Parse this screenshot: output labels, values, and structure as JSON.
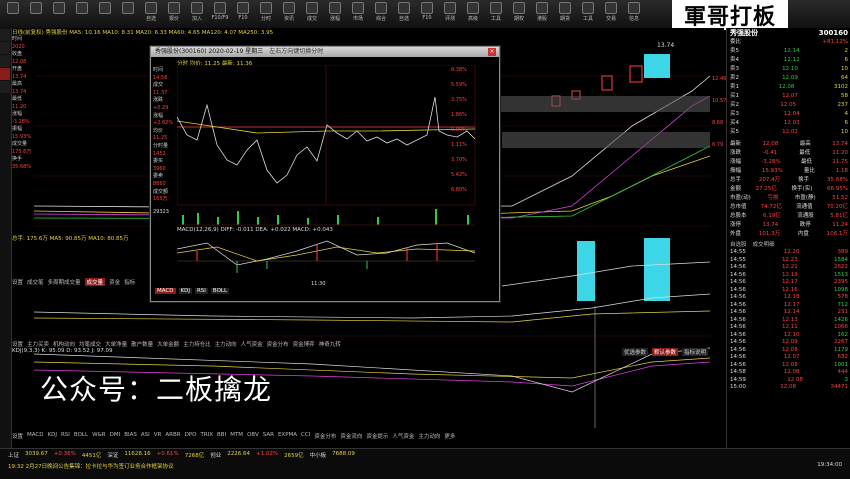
{
  "toolbar": {
    "buttons": [
      "",
      "",
      "",
      "",
      "",
      "",
      "自选",
      "报价",
      "加入",
      "F10/F9",
      "F10",
      "分时",
      "资讯",
      "成交",
      "涨幅",
      "市场",
      "综合",
      "自选",
      "F10",
      "评测",
      "高级",
      "工具",
      "期权",
      "港股",
      "期货",
      "工具",
      "交易",
      "信息"
    ]
  },
  "brand": {
    "text": "軍哥打板"
  },
  "watermark": {
    "text": "公众号：二板擒龙"
  },
  "stock": {
    "name": "秀强股份",
    "code": "300160"
  },
  "main": {
    "header": "日线(前复权)  秀强股份  MA5: 10.16  MA10: 8.31  MA20: 6.33  MA60: 4.65  MA120: 4.07  MA250: 3.95",
    "high_label": "13.74",
    "vol_header": "总手: 175.6万  MA5: 90.85万  MA10: 80.85万",
    "indicator_header": "MACD(12,26,9)",
    "tabs1": [
      "设置",
      "成交笔",
      "多周期成交量",
      "成交量",
      "资金",
      "指标"
    ],
    "tabs1_active": "成交量",
    "tabs2": [
      "设置",
      "主力买卖",
      "机构动向",
      "均笔成交",
      "大单净量",
      "散户数量",
      "大单金额",
      "主力持仓比",
      "主力动向",
      "人气资金",
      "资金分布",
      "资金博弈",
      "神奇九转"
    ],
    "tabs2_active": "资金博弈",
    "indicator2_header": "KDJ(9,3,3)  K: 95.09  D: 93.52  J: 97.09",
    "btns": [
      "优选参数",
      "默认参数",
      "指标说明"
    ],
    "bottom_tabs": [
      "设置",
      "MACD",
      "KDJ",
      "RSI",
      "BOLL",
      "W&R",
      "DMI",
      "BIAS",
      "ASI",
      "VR",
      "ARBR",
      "DPO",
      "TRIX",
      "BBI",
      "MTM",
      "OBV",
      "SAR",
      "EXPMA",
      "CCI",
      "资金分布",
      "资金流向",
      "资金提示",
      "人气资金",
      "主力动向",
      "更多"
    ],
    "bottom_active": "KDJ",
    "price_ticks": [
      "12.46",
      "10.57",
      "8.68",
      "6.79"
    ],
    "vol_ticks": [
      "3.40",
      "2.10",
      "1.50"
    ]
  },
  "popup": {
    "title": "秀强股份(300160)  2020-02-19  星期三",
    "subtitle": "左右方向键切换分时",
    "header_line": "分时  均价: 11.25  最新: 11.36",
    "fields": [
      "时间",
      "14:56",
      "成交",
      "11.37",
      "涨跌",
      "+0.29",
      "涨幅",
      "+2.62%",
      "均价",
      "11.25",
      "分时量",
      "1452",
      "委买",
      "3960",
      "委卖",
      "8860",
      "成交额",
      "165万"
    ],
    "pct_ticks": [
      "8.38%",
      "5.59%",
      "3.75%",
      "1.86%",
      "0.00%",
      "1.11%",
      "3.70%",
      "5.42%",
      "6.80%"
    ],
    "vol_label": "29323",
    "macd_header": "MACD(12,26,9)  DIFF: -0.011  DEA: +0.022  MACD: +0.043",
    "macd_ticks": [
      "+0.092",
      "+0.050",
      "0.000",
      "-0.010",
      "-0.079"
    ],
    "tabs": [
      "MACD",
      "KDJ",
      "RSI",
      "BOLL"
    ],
    "time_label": "11:30"
  },
  "right": {
    "rows": [
      {
        "l": "委比",
        "r": "+81.12%"
      },
      {
        "l": "卖5",
        "r": "12.14",
        "v": "2"
      },
      {
        "l": "卖4",
        "r": "12.12",
        "v": "6"
      },
      {
        "l": "卖3",
        "r": "12.10",
        "v": "10"
      },
      {
        "l": "卖2",
        "r": "12.09",
        "v": "64"
      },
      {
        "l": "卖1",
        "r": "12.08",
        "v": "3102"
      },
      {
        "l": "买1",
        "r": "12.07",
        "v": "58"
      },
      {
        "l": "买2",
        "r": "12.05",
        "v": "237"
      },
      {
        "l": "买3",
        "r": "12.04",
        "v": "4"
      },
      {
        "l": "买4",
        "r": "12.03",
        "v": "6"
      },
      {
        "l": "买5",
        "r": "12.02",
        "v": "10"
      }
    ],
    "quote": [
      {
        "a": "最新",
        "b": "12.08",
        "c": "最高",
        "d": "13.74"
      },
      {
        "a": "涨跌",
        "b": "-0.41",
        "c": "最低",
        "d": "11.20"
      },
      {
        "a": "涨幅",
        "b": "-3.28%",
        "c": "最低",
        "d": "11.75"
      },
      {
        "a": "振幅",
        "b": "15.93%",
        "c": "量比",
        "d": "1.18"
      },
      {
        "a": "总手",
        "b": "207.4万",
        "c": "换手",
        "d": "35.68%"
      },
      {
        "a": "金额",
        "b": "27.25亿",
        "c": "换手(实)",
        "d": "66.95%"
      },
      {
        "a": "市盈(动)",
        "b": "亏损",
        "c": "市盈(静)",
        "d": "51.52"
      },
      {
        "a": "总市值",
        "b": "74.72亿",
        "c": "流通值",
        "d": "70.20亿"
      },
      {
        "a": "总股本",
        "b": "6.19亿",
        "c": "流通股",
        "d": "5.81亿"
      },
      {
        "a": "涨停",
        "b": "13.74",
        "c": "跌停",
        "d": "11.24"
      },
      {
        "a": "外盘",
        "b": "101.3万",
        "c": "内盘",
        "d": "106.1万"
      }
    ],
    "ticks": [
      {
        "t": "14:55",
        "p": "12.20",
        "v": "389"
      },
      {
        "t": "14:55",
        "p": "12.23",
        "v": "1584"
      },
      {
        "t": "14:56",
        "p": "12.21",
        "v": "2622"
      },
      {
        "t": "14:56",
        "p": "12.19",
        "v": "1513"
      },
      {
        "t": "14:56",
        "p": "12.17",
        "v": "2395"
      },
      {
        "t": "14:56",
        "p": "12.16",
        "v": "1098"
      },
      {
        "t": "14:56",
        "p": "12.18",
        "v": "578"
      },
      {
        "t": "14:56",
        "p": "12.17",
        "v": "712"
      },
      {
        "t": "14:56",
        "p": "12.14",
        "v": "231"
      },
      {
        "t": "14:56",
        "p": "12.13",
        "v": "1426"
      },
      {
        "t": "14:56",
        "p": "12.11",
        "v": "1066"
      },
      {
        "t": "14:56",
        "p": "12.10",
        "v": "162"
      },
      {
        "t": "14:56",
        "p": "12.09",
        "v": "2267"
      },
      {
        "t": "14:56",
        "p": "12.08",
        "v": "1179"
      },
      {
        "t": "14:56",
        "p": "12.07",
        "v": "632"
      },
      {
        "t": "14:56",
        "p": "12.08",
        "v": "1001"
      },
      {
        "t": "14:58",
        "p": "12.08",
        "v": "444"
      },
      {
        "t": "14:59",
        "p": "12.08",
        "v": "3"
      },
      {
        "t": "15:00",
        "p": "12.08",
        "v": "34471"
      }
    ],
    "tab_labels": [
      "自选股",
      "成交明细"
    ]
  },
  "status": {
    "line1": [
      "上证",
      "3039.67",
      "+0.36%",
      "4451亿",
      "深证",
      "11628.16",
      "+0.61%",
      "7268亿",
      "创业",
      "2226.64",
      "+1.02%",
      "2659亿",
      "中小板",
      "7688.09"
    ],
    "line2": "19:32  2月27日晚间公告集锦：拉卡拉与华为签订业务合作框架协议",
    "time": "19:34:00"
  },
  "colors": {
    "up": "#ff4040",
    "down": "#2ecc40",
    "accent": "#8b1a1a"
  }
}
